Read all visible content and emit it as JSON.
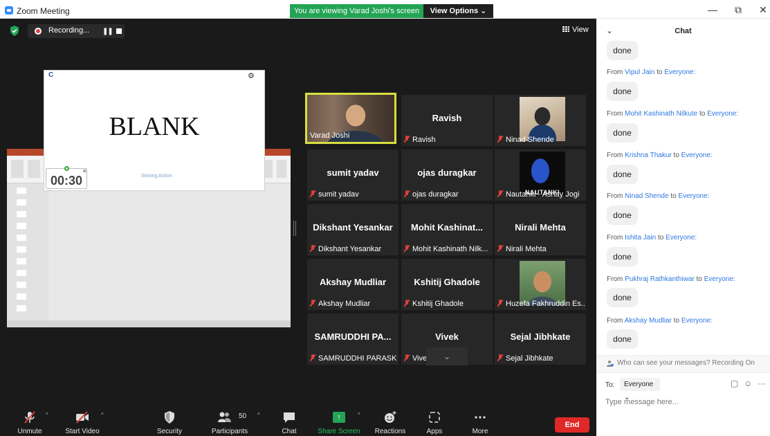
{
  "window": {
    "title": "Zoom Meeting",
    "banner": "You are viewing Varad Joshi's screen",
    "view_options": "View Options ⌄",
    "minimize": "—",
    "restore": "⧉",
    "close": "✕"
  },
  "meeting": {
    "recording_label": "Recording...",
    "pause_symbol": "❚❚",
    "view_label": "View"
  },
  "shared_screen": {
    "slide_title": "BLANK",
    "timer": "00:30",
    "slide_logo": "C",
    "slide_brand": "Striving Action"
  },
  "gallery": {
    "tiles": [
      {
        "big": "",
        "label": "Varad Joshi",
        "muted": false
      },
      {
        "big": "Ravish",
        "label": "Ravish",
        "muted": true
      },
      {
        "big": "",
        "label": "Ninad Shende",
        "muted": true
      },
      {
        "big": "sumit yadav",
        "label": "sumit yadav",
        "muted": true
      },
      {
        "big": "ojas duragkar",
        "label": "ojas duragkar",
        "muted": true
      },
      {
        "big": "",
        "label": "Nautanki - Ashay Jogi",
        "muted": true,
        "image_text": "NAUTANKI"
      },
      {
        "big": "Dikshant Yesankar",
        "label": "Dikshant Yesankar",
        "muted": true
      },
      {
        "big": "Mohit  Kashinat...",
        "label": "Mohit Kashinath Nilk...",
        "muted": true
      },
      {
        "big": "Nirali Mehta",
        "label": "Nirali Mehta",
        "muted": true
      },
      {
        "big": "Akshay Mudliar",
        "label": "Akshay Mudliar",
        "muted": true
      },
      {
        "big": "Kshitij Ghadole",
        "label": "Kshitij Ghadole",
        "muted": true
      },
      {
        "big": "",
        "label": "Huzefa Fakhruddin Es...",
        "muted": true
      },
      {
        "big": "SAMRUDDHI  PA...",
        "label": "SAMRUDDHI PARASK...",
        "muted": true
      },
      {
        "big": "Vivek",
        "label": "Vivek",
        "muted": true
      },
      {
        "big": "Sejal Jibhkate",
        "label": "Sejal Jibhkate",
        "muted": true
      }
    ],
    "scroll_down": "⌄"
  },
  "toolbar": {
    "unmute": "Unmute",
    "start_video": "Start Video",
    "security": "Security",
    "participants": "Participants",
    "participants_count": "50",
    "chat": "Chat",
    "share_screen": "Share Screen",
    "reactions": "Reactions",
    "apps": "Apps",
    "more": "More",
    "end": "End"
  },
  "chat": {
    "title": "Chat",
    "first_message": "done",
    "messages": [
      {
        "from_prefix": "From",
        "sender": "Vipul Jain",
        "to_word": "to",
        "recipient": "Everyone:",
        "text": "done"
      },
      {
        "from_prefix": "From",
        "sender": "Mohit Kashinath Nilkute",
        "to_word": "to",
        "recipient": "Everyone:",
        "text": "done"
      },
      {
        "from_prefix": "From",
        "sender": "Krishna Thakur",
        "to_word": "to",
        "recipient": "Everyone:",
        "text": "done"
      },
      {
        "from_prefix": "From",
        "sender": "Ninad Shende",
        "to_word": "to",
        "recipient": "Everyone:",
        "text": "done"
      },
      {
        "from_prefix": "From",
        "sender": "Ishita Jain",
        "to_word": "to",
        "recipient": "Everyone:",
        "text": "done"
      },
      {
        "from_prefix": "From",
        "sender": "Pukhraj Rathkanthiwar",
        "to_word": "to",
        "recipient": "Everyone:",
        "text": "done"
      },
      {
        "from_prefix": "From",
        "sender": "Akshay Mudliar",
        "to_word": "to",
        "recipient": "Everyone:",
        "text": "done"
      }
    ],
    "privacy_note": "Who can see your messages? Recording On",
    "to_label": "To:",
    "to_value": "Everyone ⌄",
    "input_placeholder": "Type message here..."
  },
  "colors": {
    "banner_green": "#23a455",
    "active_speaker": "#d7df3e",
    "end_red": "#e02828",
    "chat_link": "#2d78e0",
    "muted_red": "#e0403a"
  }
}
